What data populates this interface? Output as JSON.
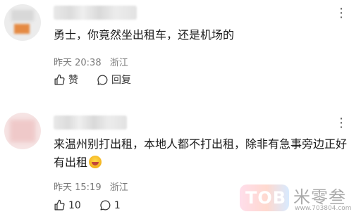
{
  "comments": [
    {
      "text": "勇士，你竟然坐出租车，还是机场的",
      "time": "昨天 20:38",
      "location": "浙江",
      "more_icon": "more-dots-icon",
      "actions": {
        "like_label": "赞",
        "reply_label": "回复"
      }
    },
    {
      "text": "来温州别打出租，本地人都不打出租，除非有急事旁边正好有出租",
      "time": "昨天 15:19",
      "location": "浙江",
      "more_icon": "more-dots-icon",
      "emoji": "crying-laughing-emoji",
      "actions": {
        "like_count": "10",
        "reply_count": "1"
      }
    }
  ],
  "watermark": {
    "badge": "TOB",
    "brand": "米零叁",
    "url": "www.703804.com"
  },
  "colors": {
    "text": "#1a1a1a",
    "meta": "#7a7a7a",
    "accent_orange": "#e58a43"
  }
}
